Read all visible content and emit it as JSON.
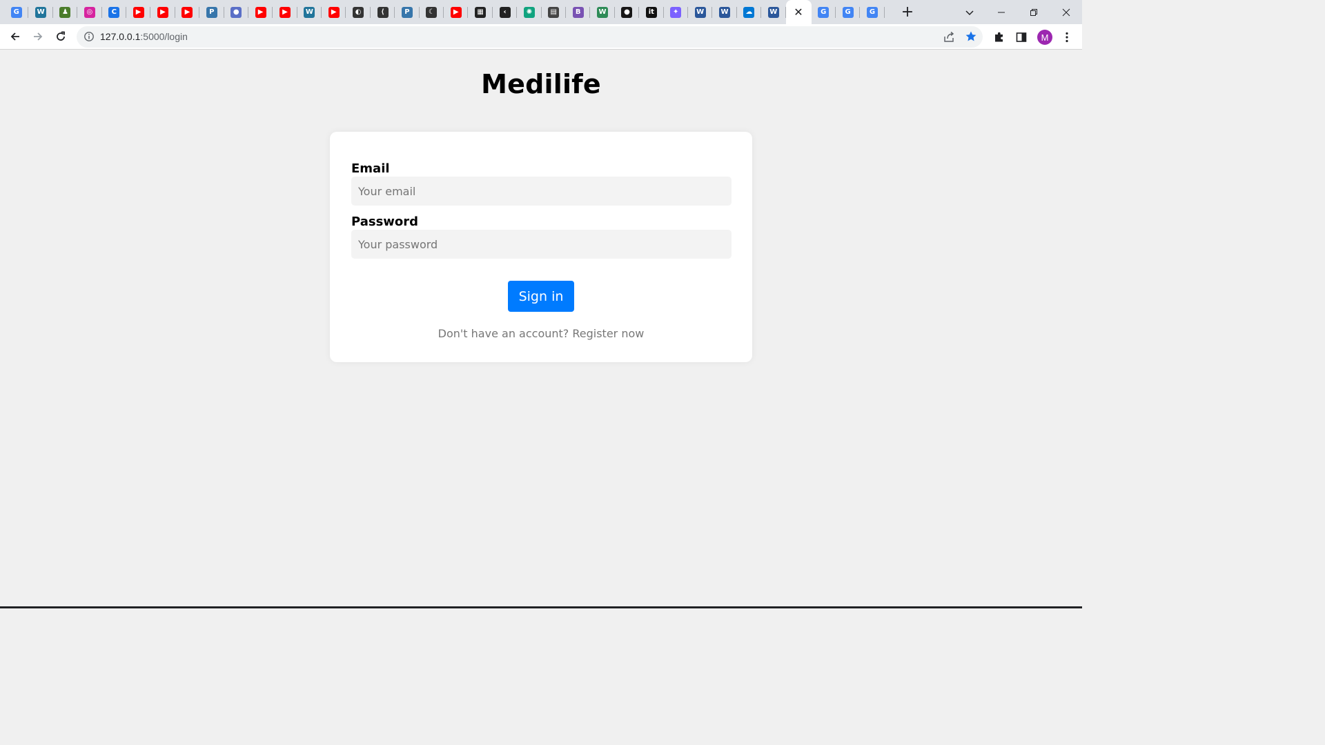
{
  "browser": {
    "tabs": [
      {
        "icon": "google-translate-icon",
        "glyph": "G",
        "color": "#4285f4"
      },
      {
        "icon": "wordpress-icon",
        "glyph": "W",
        "color": "#21759b"
      },
      {
        "icon": "chess-icon",
        "glyph": "♟",
        "color": "#4a7c2a"
      },
      {
        "icon": "instagram-icon",
        "glyph": "◎",
        "color": "#d6249f"
      },
      {
        "icon": "canva-icon",
        "glyph": "C",
        "color": "#1a73e8"
      },
      {
        "icon": "youtube-icon",
        "glyph": "▶",
        "color": "#ff0000"
      },
      {
        "icon": "youtube-icon",
        "glyph": "▶",
        "color": "#ff0000"
      },
      {
        "icon": "youtube-icon",
        "glyph": "▶",
        "color": "#ff0000"
      },
      {
        "icon": "python-icon",
        "glyph": "P",
        "color": "#3776ab"
      },
      {
        "icon": "location-pin-icon",
        "glyph": "●",
        "color": "#5a6fc7"
      },
      {
        "icon": "youtube-icon",
        "glyph": "▶",
        "color": "#ff0000"
      },
      {
        "icon": "youtube-icon",
        "glyph": "▶",
        "color": "#ff0000"
      },
      {
        "icon": "wordpress-icon",
        "glyph": "W",
        "color": "#21759b"
      },
      {
        "icon": "youtube-icon",
        "glyph": "▶",
        "color": "#ff0000"
      },
      {
        "icon": "globe-icon",
        "glyph": "◐",
        "color": "#333333"
      },
      {
        "icon": "curve-icon",
        "glyph": "⟨",
        "color": "#333333"
      },
      {
        "icon": "python-icon",
        "glyph": "P",
        "color": "#3776ab"
      },
      {
        "icon": "phone-icon",
        "glyph": "☾",
        "color": "#333333"
      },
      {
        "icon": "youtube-icon",
        "glyph": "▶",
        "color": "#ff0000"
      },
      {
        "icon": "image-icon",
        "glyph": "▦",
        "color": "#222222"
      },
      {
        "icon": "chevron-icon",
        "glyph": "‹",
        "color": "#222222"
      },
      {
        "icon": "chatgpt-icon",
        "glyph": "✺",
        "color": "#10a37f"
      },
      {
        "icon": "grid-icon",
        "glyph": "▤",
        "color": "#444444"
      },
      {
        "icon": "bootstrap-icon",
        "glyph": "B",
        "color": "#7952b3"
      },
      {
        "icon": "w-logo-icon",
        "glyph": "W",
        "color": "#2e8b57"
      },
      {
        "icon": "github-icon",
        "glyph": "●",
        "color": "#181717"
      },
      {
        "icon": "it-logo-icon",
        "glyph": "it",
        "color": "#111111"
      },
      {
        "icon": "sparkle-icon",
        "glyph": "✦",
        "color": "#7b61ff"
      },
      {
        "icon": "word-icon",
        "glyph": "W",
        "color": "#2b579a"
      },
      {
        "icon": "word-icon",
        "glyph": "W",
        "color": "#2b579a"
      },
      {
        "icon": "onedrive-icon",
        "glyph": "☁",
        "color": "#0078d4"
      },
      {
        "icon": "word-icon",
        "glyph": "W",
        "color": "#2b579a"
      },
      {
        "icon": "active-tab-close-icon",
        "glyph": "✕",
        "color": "#202124",
        "active": true
      },
      {
        "icon": "google-icon",
        "glyph": "G",
        "color": "#4285f4"
      },
      {
        "icon": "google-icon",
        "glyph": "G",
        "color": "#4285f4"
      },
      {
        "icon": "google-icon",
        "glyph": "G",
        "color": "#4285f4"
      }
    ],
    "new_tab_glyph": "+",
    "url_host": "127.0.0.1",
    "url_path": ":5000/login",
    "profile_initial": "M",
    "accent_color": "#1a73e8",
    "profile_color": "#9c27b0"
  },
  "page": {
    "title": "Medilife",
    "form": {
      "email_label": "Email",
      "email_placeholder": "Your email",
      "password_label": "Password",
      "password_placeholder": "Your password",
      "submit_label": "Sign in",
      "register_text": "Don't have an account? Register now"
    },
    "colors": {
      "background": "#f0f0f0",
      "card": "#ffffff",
      "button": "#007bff",
      "input": "#f3f3f3"
    }
  }
}
